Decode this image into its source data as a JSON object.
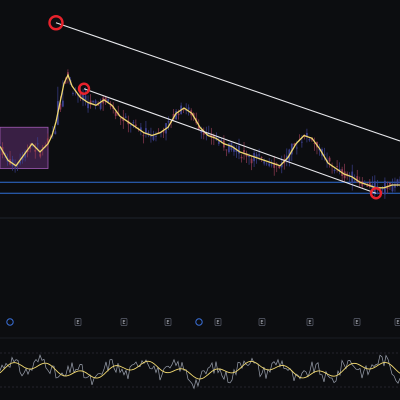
{
  "chart_data": {
    "type": "candlestick",
    "title": "",
    "xlabel": "",
    "ylabel": "",
    "grid": false,
    "legend": "none",
    "x_range": [
      0,
      100
    ],
    "y_range": [
      0,
      100
    ],
    "colors": {
      "background": "#0c0d10",
      "candle_up": "#8f3b52",
      "candle_down": "#3b3f8c",
      "moving_average": "#f0d870",
      "trendline": "#e8e8ec",
      "marker": "#e8222c",
      "range_box": "#7a3a8c",
      "level": "#2f6fd6",
      "oscillator": "#9aa0ad",
      "oscillator_ma": "#f0d870"
    },
    "moving_average": [
      [
        0,
        54
      ],
      [
        2,
        49
      ],
      [
        4,
        47
      ],
      [
        6,
        51
      ],
      [
        8,
        55
      ],
      [
        10,
        52
      ],
      [
        12,
        55
      ],
      [
        13,
        58
      ],
      [
        14,
        63
      ],
      [
        15,
        70
      ],
      [
        16,
        77
      ],
      [
        17,
        80
      ],
      [
        18,
        76
      ],
      [
        20,
        72
      ],
      [
        22,
        70
      ],
      [
        24,
        69
      ],
      [
        26,
        71
      ],
      [
        28,
        69
      ],
      [
        30,
        65
      ],
      [
        32,
        63
      ],
      [
        34,
        61
      ],
      [
        36,
        59
      ],
      [
        38,
        58
      ],
      [
        40,
        59
      ],
      [
        42,
        61
      ],
      [
        44,
        66
      ],
      [
        46,
        68
      ],
      [
        48,
        66
      ],
      [
        50,
        61
      ],
      [
        52,
        58
      ],
      [
        54,
        57
      ],
      [
        56,
        55
      ],
      [
        58,
        54
      ],
      [
        60,
        52
      ],
      [
        62,
        51
      ],
      [
        64,
        50
      ],
      [
        66,
        49
      ],
      [
        68,
        48
      ],
      [
        70,
        47
      ],
      [
        72,
        50
      ],
      [
        74,
        55
      ],
      [
        76,
        58
      ],
      [
        78,
        57
      ],
      [
        80,
        53
      ],
      [
        82,
        48
      ],
      [
        84,
        46
      ],
      [
        86,
        44
      ],
      [
        88,
        43
      ],
      [
        90,
        41
      ],
      [
        92,
        40
      ],
      [
        94,
        39
      ],
      [
        96,
        39
      ],
      [
        98,
        40
      ],
      [
        100,
        40
      ]
    ],
    "resistance_line": {
      "from": [
        14,
        99
      ],
      "to": [
        100,
        56
      ]
    },
    "support_line": {
      "from": [
        21,
        75
      ],
      "to": [
        94,
        37
      ]
    },
    "markers": [
      [
        14,
        99
      ],
      [
        21,
        75
      ],
      [
        94,
        37
      ]
    ],
    "range_box": {
      "x": [
        0,
        12
      ],
      "y": [
        46,
        61
      ]
    },
    "levels": [
      41,
      37
    ],
    "event_labels": [
      "E",
      "E",
      "E",
      "E",
      "E",
      "E",
      "E",
      "E"
    ]
  }
}
